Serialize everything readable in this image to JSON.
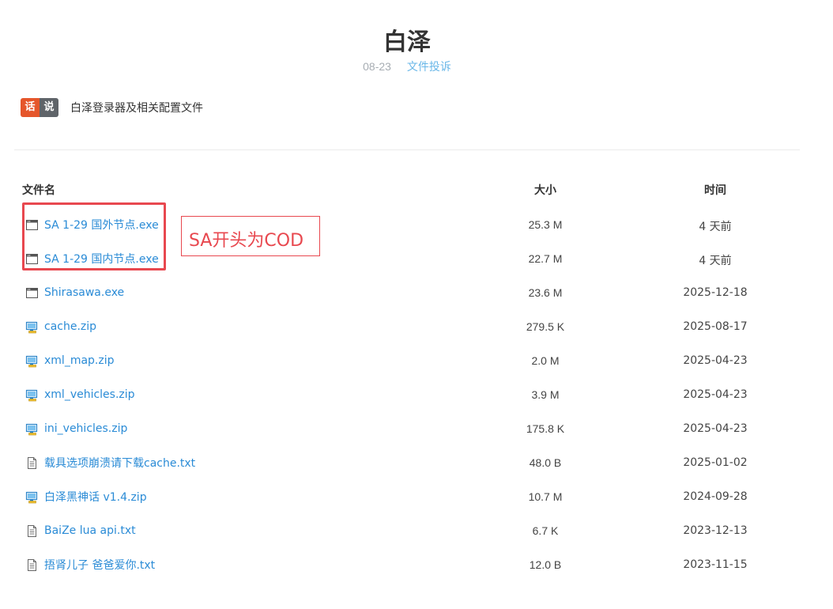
{
  "header": {
    "title": "白泽",
    "date": "08-23",
    "category": "文件投诉"
  },
  "tag": {
    "part1": "话",
    "part2": "说",
    "description": "白泽登录器及相关配置文件"
  },
  "table": {
    "headers": {
      "name": "文件名",
      "size": "大小",
      "time": "时间"
    },
    "rows": [
      {
        "icon": "exe-file-icon",
        "name": "SA 1-29 国外节点.exe",
        "size": "25.3 M",
        "time": "4 天前"
      },
      {
        "icon": "exe-file-icon",
        "name": "SA 1-29 国内节点.exe",
        "size": "22.7 M",
        "time": "4 天前"
      },
      {
        "icon": "exe-file-icon",
        "name": "Shirasawa.exe",
        "size": "23.6 M",
        "time": "2025-12-18"
      },
      {
        "icon": "zip-file-icon",
        "name": "cache.zip",
        "size": "279.5 K",
        "time": "2025-08-17"
      },
      {
        "icon": "zip-file-icon",
        "name": "xml_map.zip",
        "size": "2.0 M",
        "time": "2025-04-23"
      },
      {
        "icon": "zip-file-icon",
        "name": "xml_vehicles.zip",
        "size": "3.9 M",
        "time": "2025-04-23"
      },
      {
        "icon": "zip-file-icon",
        "name": "ini_vehicles.zip",
        "size": "175.8 K",
        "time": "2025-04-23"
      },
      {
        "icon": "txt-file-icon",
        "name": "载具选项崩溃请下载cache.txt",
        "size": "48.0 B",
        "time": "2025-01-02"
      },
      {
        "icon": "zip-file-icon",
        "name": "白泽黑神话 v1.4.zip",
        "size": "10.7 M",
        "time": "2024-09-28"
      },
      {
        "icon": "txt-file-icon",
        "name": "BaiZe lua api.txt",
        "size": "6.7 K",
        "time": "2023-12-13"
      },
      {
        "icon": "txt-file-icon",
        "name": "捂肾儿子 爸爸爱你.txt",
        "size": "12.0 B",
        "time": "2023-11-15"
      }
    ]
  },
  "annotation": {
    "note": "SA开头为COD",
    "color": "#e8484f"
  },
  "colors": {
    "link": "#2a8bd6",
    "category": "#69b7e8",
    "tag_orange": "#e5562b",
    "tag_gray": "#5f6469"
  }
}
